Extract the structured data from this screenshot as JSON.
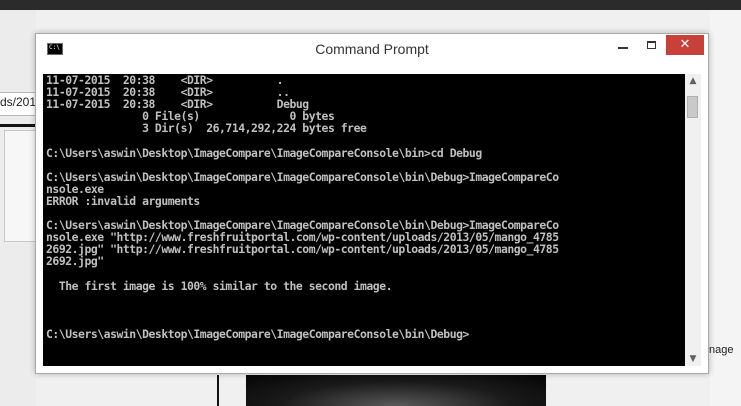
{
  "background": {
    "address_fragment": "ds/201",
    "right_fragment": "nage"
  },
  "window": {
    "title": "Command Prompt",
    "icon_label": "C:\\",
    "minimize_icon": "minimize-icon",
    "maximize_icon": "maximize-icon",
    "close_symbol": "✕"
  },
  "console": {
    "lines": [
      "11-07-2015  20:38    <DIR>          .",
      "11-07-2015  20:38    <DIR>          ..",
      "11-07-2015  20:38    <DIR>          Debug",
      "               0 File(s)              0 bytes",
      "               3 Dir(s)  26,714,292,224 bytes free",
      "",
      "C:\\Users\\aswin\\Desktop\\ImageCompare\\ImageCompareConsole\\bin>cd Debug",
      "",
      "C:\\Users\\aswin\\Desktop\\ImageCompare\\ImageCompareConsole\\bin\\Debug>ImageCompareCo",
      "nsole.exe",
      "ERROR :invalid arguments",
      "",
      "C:\\Users\\aswin\\Desktop\\ImageCompare\\ImageCompareConsole\\bin\\Debug>ImageCompareCo",
      "nsole.exe \"http://www.freshfruitportal.com/wp-content/uploads/2013/05/mango_4785",
      "2692.jpg\" \"http://www.freshfruitportal.com/wp-content/uploads/2013/05/mango_4785",
      "2692.jpg\"",
      "",
      "  The first image is 100% similar to the second image.",
      "",
      "",
      "",
      "C:\\Users\\aswin\\Desktop\\ImageCompare\\ImageCompareConsole\\bin\\Debug>"
    ]
  },
  "scrollbar": {
    "up_arrow": "▲",
    "down_arrow": "▼"
  }
}
